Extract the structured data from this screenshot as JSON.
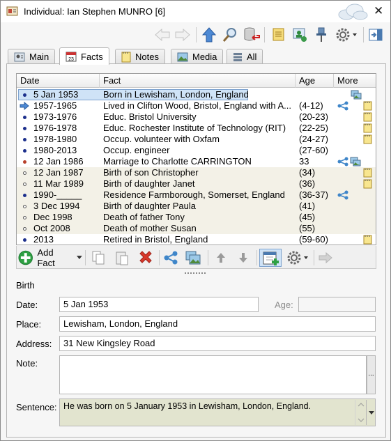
{
  "window": {
    "title": "Individual: Ian Stephen MUNRO [6]",
    "close_glyph": "✕"
  },
  "toolbar": {
    "buttons": [
      "back-arrow-icon",
      "forward-arrow-icon",
      "up-arrow-icon",
      "find-icon",
      "database-icon",
      "scroll-icon",
      "person-tree-icon",
      "pin-icon",
      "gear-icon",
      "exit-icon"
    ]
  },
  "tabs": [
    {
      "label": "Main",
      "icon": "person-card-icon",
      "active": false
    },
    {
      "label": "Facts",
      "icon": "calendar-icon",
      "active": true
    },
    {
      "label": "Notes",
      "icon": "note-icon",
      "active": false
    },
    {
      "label": "Media",
      "icon": "picture-icon",
      "active": false
    },
    {
      "label": "All",
      "icon": "list-icon",
      "active": false
    }
  ],
  "grid": {
    "columns": [
      "Date",
      "Fact",
      "Age",
      "More"
    ],
    "rows": [
      {
        "date": "5 Jan 1953",
        "fact": "Born in Lewisham, London, England",
        "age": "",
        "bullet": "dot-blue",
        "more": [
          "media"
        ],
        "selected": true
      },
      {
        "date": "1957-1965",
        "fact": "Lived in Clifton Wood, Bristol, England with A...",
        "age": "(4-12)",
        "bullet": "arrow",
        "more": [
          "share",
          "note"
        ],
        "selected": false
      },
      {
        "date": "1973-1976",
        "fact": "Educ. Bristol University",
        "age": "(20-23)",
        "bullet": "dot-blue",
        "more": [
          "note"
        ],
        "selected": false
      },
      {
        "date": "1976-1978",
        "fact": "Educ. Rochester Institute of Technology (RIT)",
        "age": "(22-25)",
        "bullet": "dot-blue",
        "more": [
          "note"
        ],
        "selected": false
      },
      {
        "date": "1978-1980",
        "fact": "Occup. volunteer with Oxfam",
        "age": "(24-27)",
        "bullet": "dot-blue",
        "more": [
          "note"
        ],
        "selected": false
      },
      {
        "date": "1980-2013",
        "fact": "Occup. engineer",
        "age": "(27-60)",
        "bullet": "dot-blue",
        "more": [],
        "selected": false
      },
      {
        "date": "12 Jan 1986",
        "fact": "Marriage to Charlotte CARRINGTON",
        "age": "33",
        "bullet": "dot-red",
        "more": [
          "share",
          "media"
        ],
        "selected": false
      },
      {
        "date": "12 Jan 1987",
        "fact": "Birth of son Christopher",
        "age": "(34)",
        "bullet": "dot-hollow",
        "more": [
          "note"
        ],
        "selected": false
      },
      {
        "date": "11 Mar 1989",
        "fact": "Birth of daughter Janet",
        "age": "(36)",
        "bullet": "dot-hollow",
        "more": [
          "note"
        ],
        "selected": false
      },
      {
        "date": "1990-_____",
        "fact": "Residence Farmborough, Somerset, England",
        "age": "(36-37)",
        "bullet": "dot-blue",
        "more": [
          "share"
        ],
        "selected": false
      },
      {
        "date": "3 Dec 1994",
        "fact": "Birth of daughter Paula",
        "age": "(41)",
        "bullet": "dot-hollow",
        "more": [],
        "selected": false
      },
      {
        "date": "Dec 1998",
        "fact": "Death of father Tony",
        "age": "(45)",
        "bullet": "dot-hollow",
        "more": [],
        "selected": false
      },
      {
        "date": "Oct 2008",
        "fact": "Death of mother Susan",
        "age": "(55)",
        "bullet": "dot-hollow",
        "more": [],
        "selected": false
      },
      {
        "date": "2013",
        "fact": "Retired in Bristol, England",
        "age": "(59-60)",
        "bullet": "dot-blue",
        "more": [
          "note"
        ],
        "selected": false
      }
    ]
  },
  "bottombar": {
    "add_fact_label": "Add Fact"
  },
  "detail": {
    "section_title": "Birth",
    "date_label": "Date:",
    "date_value": "5 Jan 1953",
    "age_label": "Age:",
    "age_value": "",
    "place_label": "Place:",
    "place_value": "Lewisham, London, England",
    "address_label": "Address:",
    "address_value": "31 New Kingsley Road",
    "note_label": "Note:",
    "note_value": "",
    "note_button": "...",
    "sentence_label": "Sentence:",
    "sentence_value": "He was born on 5 January 1953 in Lewisham, London, England."
  },
  "colors": {
    "selection": "#cfe3f7",
    "alt_row": "#f3f1e7",
    "sentence_bg": "#e2e4cf",
    "dot_blue": "#1c2f8c",
    "dot_red": "#b8402a"
  }
}
